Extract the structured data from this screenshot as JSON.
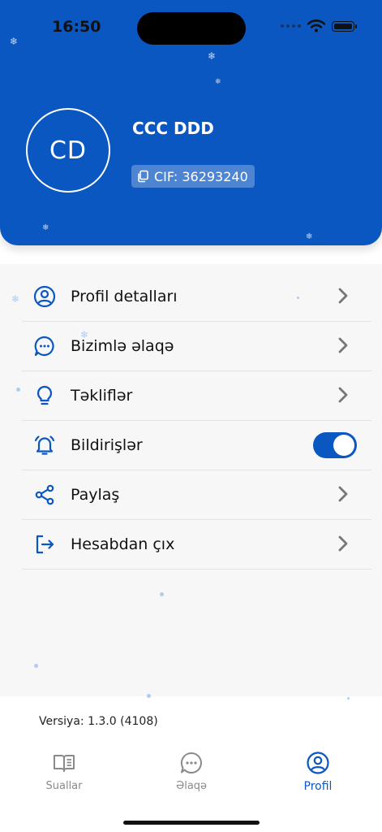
{
  "status_bar": {
    "time": "16:50"
  },
  "profile": {
    "initials": "CD",
    "name": "CCC DDD",
    "cif": "CIF: 36293240"
  },
  "menu": {
    "items": [
      {
        "label": "Profil detalları",
        "icon": "user-circle-icon"
      },
      {
        "label": "Bizimlə əlaqə",
        "icon": "chat-bubble-icon"
      },
      {
        "label": "Təkliflər",
        "icon": "lightbulb-icon"
      },
      {
        "label": "Bildirişlər",
        "icon": "bell-icon",
        "toggle_on": true
      },
      {
        "label": "Paylaş",
        "icon": "share-icon"
      },
      {
        "label": "Hesabdan çıx",
        "icon": "logout-icon"
      }
    ]
  },
  "version": "Versiya: 1.3.0 (4108)",
  "tabbar": {
    "tabs": [
      {
        "label": "Suallar",
        "icon": "book-icon",
        "active": false
      },
      {
        "label": "Əlaqə",
        "icon": "chat-bubble-icon",
        "active": false
      },
      {
        "label": "Profil",
        "icon": "user-circle-icon",
        "active": true
      }
    ]
  },
  "colors": {
    "accent": "#0a57c2",
    "background": "#f7f7f7"
  }
}
